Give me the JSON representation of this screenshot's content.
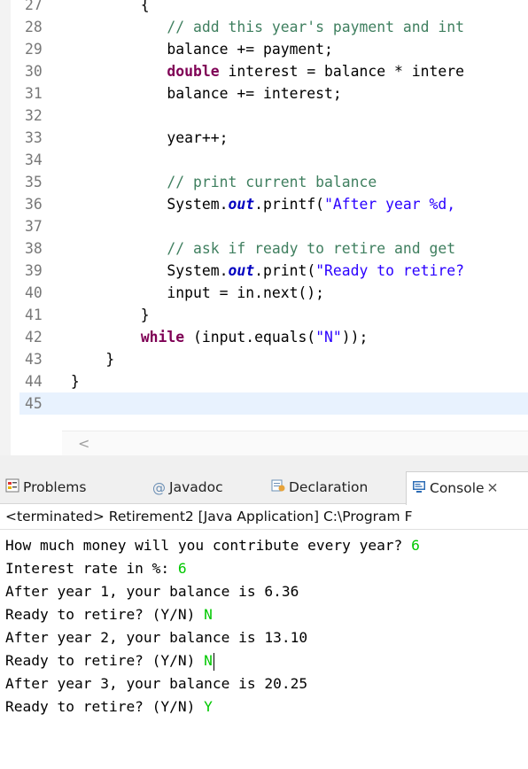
{
  "editor": {
    "lines": [
      {
        "num": "27",
        "parts": [
          {
            "t": "         {",
            "c": ""
          }
        ]
      },
      {
        "num": "28",
        "parts": [
          {
            "t": "            ",
            "c": ""
          },
          {
            "t": "// add this year's payment and int",
            "c": "cm"
          }
        ]
      },
      {
        "num": "29",
        "parts": [
          {
            "t": "            balance += payment;",
            "c": ""
          }
        ]
      },
      {
        "num": "30",
        "parts": [
          {
            "t": "            ",
            "c": ""
          },
          {
            "t": "double",
            "c": "kw"
          },
          {
            "t": " interest = balance * intere",
            "c": ""
          }
        ]
      },
      {
        "num": "31",
        "parts": [
          {
            "t": "            balance += interest;",
            "c": ""
          }
        ]
      },
      {
        "num": "32",
        "parts": []
      },
      {
        "num": "33",
        "parts": [
          {
            "t": "            year++;",
            "c": ""
          }
        ]
      },
      {
        "num": "34",
        "parts": []
      },
      {
        "num": "35",
        "parts": [
          {
            "t": "            ",
            "c": ""
          },
          {
            "t": "// print current balance",
            "c": "cm"
          }
        ]
      },
      {
        "num": "36",
        "parts": [
          {
            "t": "            System.",
            "c": ""
          },
          {
            "t": "out",
            "c": "fld"
          },
          {
            "t": ".printf(",
            "c": ""
          },
          {
            "t": "\"After year %d, ",
            "c": "st"
          }
        ]
      },
      {
        "num": "37",
        "parts": []
      },
      {
        "num": "38",
        "parts": [
          {
            "t": "            ",
            "c": ""
          },
          {
            "t": "// ask if ready to retire and get",
            "c": "cm"
          }
        ]
      },
      {
        "num": "39",
        "parts": [
          {
            "t": "            System.",
            "c": ""
          },
          {
            "t": "out",
            "c": "fld"
          },
          {
            "t": ".print(",
            "c": ""
          },
          {
            "t": "\"Ready to retire?",
            "c": "st"
          }
        ]
      },
      {
        "num": "40",
        "parts": [
          {
            "t": "            input = in.next();",
            "c": ""
          }
        ]
      },
      {
        "num": "41",
        "parts": [
          {
            "t": "         }",
            "c": ""
          }
        ]
      },
      {
        "num": "42",
        "parts": [
          {
            "t": "         ",
            "c": ""
          },
          {
            "t": "while",
            "c": "kw"
          },
          {
            "t": " (input.equals(",
            "c": ""
          },
          {
            "t": "\"N\"",
            "c": "st"
          },
          {
            "t": "));",
            "c": ""
          }
        ]
      },
      {
        "num": "43",
        "parts": [
          {
            "t": "     }",
            "c": ""
          }
        ]
      },
      {
        "num": "44",
        "parts": [
          {
            "t": " }",
            "c": ""
          }
        ]
      },
      {
        "num": "45",
        "parts": []
      }
    ],
    "scroll_left_glyph": "<"
  },
  "views": {
    "tabs": [
      {
        "label": "Problems",
        "icon": "problems-icon"
      },
      {
        "label": "Javadoc",
        "icon": "javadoc-icon"
      },
      {
        "label": "Declaration",
        "icon": "declaration-icon"
      },
      {
        "label": "Console",
        "icon": "console-icon"
      }
    ],
    "status": "<terminated> Retirement2 [Java Application] C:\\Program F"
  },
  "console": {
    "lines": [
      {
        "prompt": "How much money will you contribute every year? ",
        "input": "6"
      },
      {
        "prompt": "Interest rate in %: ",
        "input": "6"
      },
      {
        "prompt": "After year 1, your balance is 6.36",
        "input": ""
      },
      {
        "prompt": "Ready to retire? (Y/N) ",
        "input": "N"
      },
      {
        "prompt": "After year 2, your balance is 13.10",
        "input": ""
      },
      {
        "prompt": "Ready to retire? (Y/N) ",
        "input": "N"
      },
      {
        "prompt": "After year 3, your balance is 20.25",
        "input": ""
      },
      {
        "prompt": "Ready to retire? (Y/N) ",
        "input": "Y"
      }
    ]
  },
  "colors": {
    "keyword": "#7f0055",
    "comment": "#3f7f5f",
    "string": "#2a00ff",
    "user_input": "#00c800",
    "current_line": "#e8f2fe"
  }
}
